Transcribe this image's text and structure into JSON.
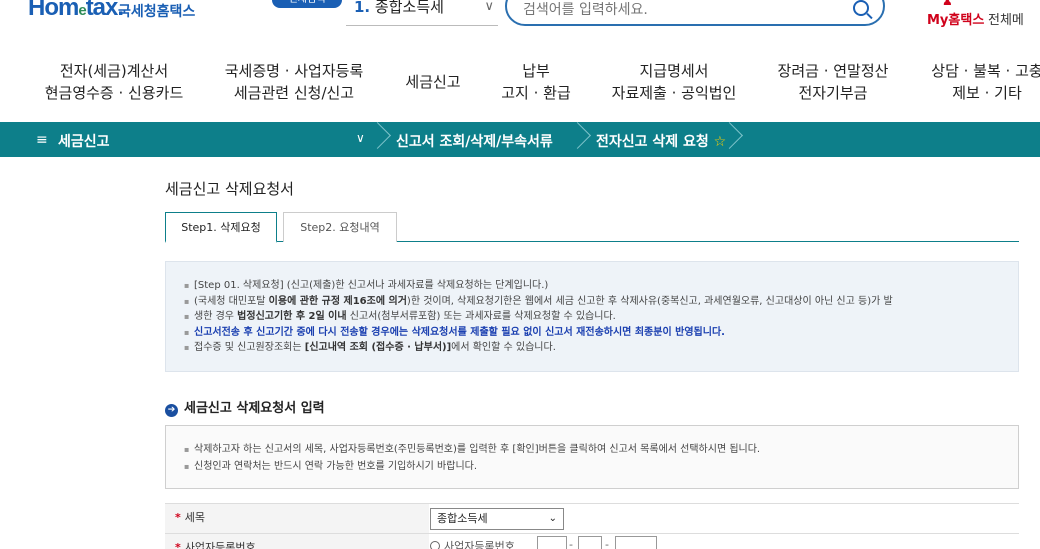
{
  "header": {
    "logo_main": "Hom",
    "logo_e": "e",
    "logo_tail": "tax.",
    "logo_kr": "국세청홈택스",
    "badge": "전체검색",
    "search_category_num": "1.",
    "search_category": "종합소득세",
    "search_placeholder": "검색어를 입력하세요.",
    "my_prefix": "My",
    "my_label": "홈택스",
    "menu_all": "전체메"
  },
  "gnb": [
    {
      "line1": "전자(세금)계산서",
      "line2": "현금영수증 · 신용카드"
    },
    {
      "line1": "국세증명 · 사업자등록",
      "line2": "세금관련 신청/신고"
    },
    {
      "line1": "세금신고",
      "line2": ""
    },
    {
      "line1": "납부",
      "line2": "고지 · 환급"
    },
    {
      "line1": "지급명세서",
      "line2": "자료제출 · 공익법인"
    },
    {
      "line1": "장려금 · 연말정산",
      "line2": "전자기부금"
    },
    {
      "line1": "상담 · 불복 · 고충",
      "line2": "제보 · 기타"
    }
  ],
  "breadcrumb": {
    "menu_icon": "≡",
    "root": "세금신고",
    "chev": "∨",
    "level2": "신고서 조회/삭제/부속서류",
    "level3": "전자신고 삭제 요청",
    "star": "☆"
  },
  "page": {
    "title": "세금신고 삭제요청서",
    "tabs": [
      "Step1. 삭제요청",
      "Step2. 요청내역"
    ]
  },
  "info": {
    "l1": "[Step 01. 삭제요청] (신고(제출)한 신고서나 과세자료를 삭제요청하는 단계입니다.)",
    "l2a": "(국세청 대민포탈 ",
    "l2b": "이용에 관한 규정 제16조에 의거",
    "l2c": ")한 것이며, 삭제요청기한은 웹에서 세금 신고한 후 삭제사유(중복신고, 과세연월오류, 신고대상이 아닌 신고 등)가 발",
    "l3a": "생한 경우 ",
    "l3b": "법정신고기한 후 2일 이내",
    "l3c": " 신고서(첨부서류포함) 또는 과세자료를 삭제요청할 수 있습니다.",
    "l4": "신고서전송 후 신고기간 중에 다시 전송할 경우에는 삭제요청서를 제출할 필요 없이 신고서 재전송하시면 최종분이 반영됩니다.",
    "l5a": "접수증 및 신고원장조회는 ",
    "l5b": "[신고내역 조회 (접수증 · 납부서)]",
    "l5c": "에서 확인할 수 있습니다."
  },
  "section": {
    "icon": "➔",
    "title": "세금신고 삭제요청서 입력"
  },
  "guide": {
    "l1": "삭제하고자 하는 신고서의 세목, 사업자등록번호(주민등록번호)를 입력한 후 [확인]버튼을 클릭하여 신고서 목록에서 선택하시면 됩니다.",
    "l2": "신청인과 연락처는 반드시 연락 가능한 번호를 기입하시기 바랍니다."
  },
  "form": {
    "req_mark": "*",
    "tax_label": "세목",
    "tax_value": "종합소득세",
    "biz_label": "사업자등록번호",
    "biz_radio": "사업자등록번호",
    "dash": "-"
  }
}
